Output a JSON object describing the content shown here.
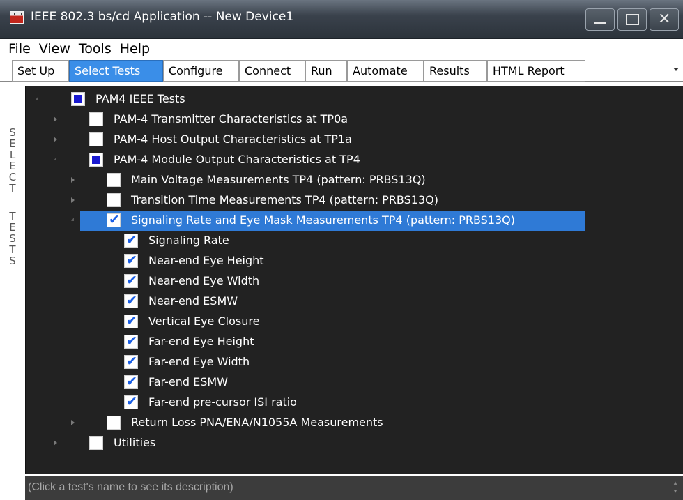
{
  "window": {
    "title": "IEEE 802.3 bs/cd Application -- New Device1"
  },
  "menu": [
    {
      "accel": "F",
      "rest": "ile"
    },
    {
      "accel": "V",
      "rest": "iew"
    },
    {
      "accel": "T",
      "rest": "ools"
    },
    {
      "accel": "H",
      "rest": "elp"
    }
  ],
  "tabs": [
    "Set Up",
    "Select Tests",
    "Configure",
    "Connect",
    "Run",
    "Automate",
    "Results",
    "HTML Report"
  ],
  "active_tab": "Select Tests",
  "side_label": "SELECT TESTS",
  "tree": {
    "root": "PAM4 IEEE Tests",
    "tx": "PAM-4 Transmitter Characteristics at TP0a",
    "host": "PAM-4 Host Output Characteristics at TP1a",
    "module": "PAM-4 Module Output Characteristics at TP4",
    "main_voltage": "Main Voltage Measurements TP4 (pattern: PRBS13Q)",
    "transition": "Transition Time Measurements TP4 (pattern: PRBS13Q)",
    "signaling": "Signaling Rate and Eye Mask Measurements TP4 (pattern: PRBS13Q)",
    "leaves": [
      "Signaling Rate",
      "Near-end Eye Height",
      "Near-end Eye Width",
      "Near-end ESMW",
      "Vertical Eye Closure",
      "Far-end Eye Height",
      "Far-end Eye Width",
      "Far-end ESMW",
      "Far-end pre-cursor ISI ratio"
    ],
    "return_loss": "Return Loss PNA/ENA/N1055A Measurements",
    "utilities": "Utilities"
  },
  "description": "(Click a test's name to see its description)",
  "colors": {
    "selection": "#2f7ad6",
    "active_tab": "#3a8ee8",
    "tree_bg": "#222222",
    "check": "#1a5fe6",
    "partial": "#1a1ad0"
  }
}
